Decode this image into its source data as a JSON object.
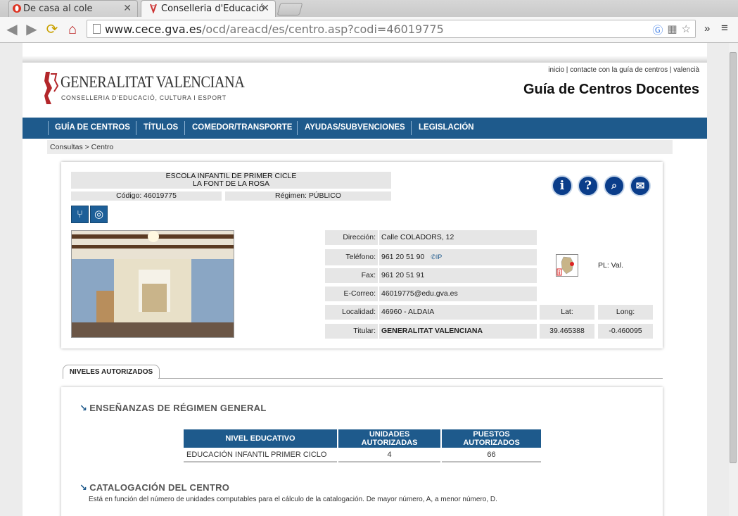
{
  "browser": {
    "tabs": [
      {
        "title": "De casa al cole",
        "active": false
      },
      {
        "title": "Conselleria d'Educació",
        "active": true
      }
    ],
    "url_domain": "www.cece.gva.es",
    "url_path": "/ocd/areacd/es/centro.asp?codi=46019775"
  },
  "header": {
    "top_links": "inicio | contacte con la guía de centros | valencià",
    "site_title": "Guía de Centros Docentes",
    "logo_title": "GENERALITAT VALENCIANA",
    "logo_subtitle": "CONSELLERIA D'EDUCACIÓ, CULTURA I ESPORT"
  },
  "menu": [
    "GUÍA DE CENTROS",
    "TÍTULOS",
    "COMEDOR/TRANSPORTE",
    "AYUDAS/SUBVENCIONES",
    "LEGISLACIÓN"
  ],
  "breadcrumb": "Consultas > Centro",
  "center": {
    "name_line1": "ESCOLA INFANTIL DE PRIMER CICLE",
    "name_line2": "LA FONT DE LA ROSA",
    "code": "Código: 46019775",
    "regime": "Régimen: PÚBLICO",
    "address_label": "Dirección:",
    "address": "Calle COLADORS, 12",
    "phone_label": "Teléfono:",
    "phone": "961 20 51 90",
    "phone_ip": "IP",
    "fax_label": "Fax:",
    "fax": "961 20 51 91",
    "email_label": "E-Correo:",
    "email": "46019775@edu.gva.es",
    "locality_label": "Localidad:",
    "locality": "46960 - ALDAIA",
    "owner_label": "Titular:",
    "owner": "GENERALITAT VALENCIANA",
    "lat_label": "Lat:",
    "lat": "39.465388",
    "long_label": "Long:",
    "long": "-0.460095",
    "pl": "PL: Val."
  },
  "icons": [
    "info-icon",
    "help-icon",
    "search-map-icon",
    "mail-icon",
    "cutlery-icon",
    "transport-icon"
  ],
  "tab_label": "NIVELES AUTORIZADOS",
  "regimen_general": {
    "heading": "ENSEÑANZAS DE RÉGIMEN GENERAL",
    "columns": [
      "NIVEL EDUCATIVO",
      "UNIDADES AUTORIZADAS",
      "PUESTOS AUTORIZADOS"
    ],
    "rows": [
      [
        "EDUCACIÓN INFANTIL PRIMER CICLO",
        "4",
        "66"
      ]
    ]
  },
  "catalogacion": {
    "heading": "CATALOGACIÓN DEL CENTRO",
    "description": "Está en función del número de unidades computables para el cálculo de la catalogación. De mayor número, A, a menor número, D."
  }
}
